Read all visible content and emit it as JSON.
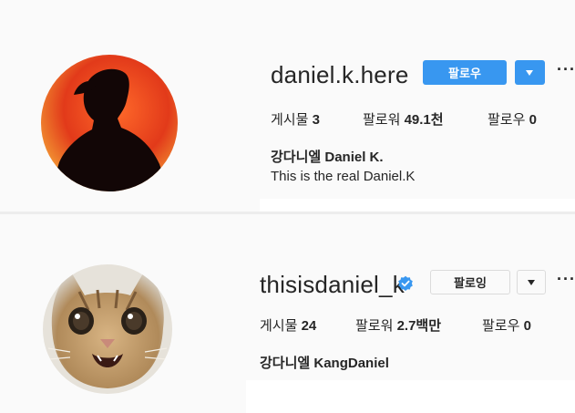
{
  "profiles": [
    {
      "username": "daniel.k.here",
      "follow_label": "팔로우",
      "more_label": "···",
      "posts_label": "게시물",
      "posts_value": "3",
      "followers_label": "팔로워",
      "followers_value": "49.1천",
      "following_label": "팔로우",
      "following_value": "0",
      "full_name": "강다니엘 Daniel K.",
      "bio": "This is the real Daniel.K"
    },
    {
      "username": "thisisdaniel_k",
      "verified": true,
      "follow_label": "팔로잉",
      "more_label": "···",
      "posts_label": "게시물",
      "posts_value": "24",
      "followers_label": "팔로워",
      "followers_value": "2.7백만",
      "following_label": "팔로우",
      "following_value": "0",
      "full_name": "강다니엘 KangDaniel"
    }
  ],
  "colors": {
    "follow_blue": "#3897f0",
    "verified_blue": "#3897f0",
    "text": "#262626"
  }
}
